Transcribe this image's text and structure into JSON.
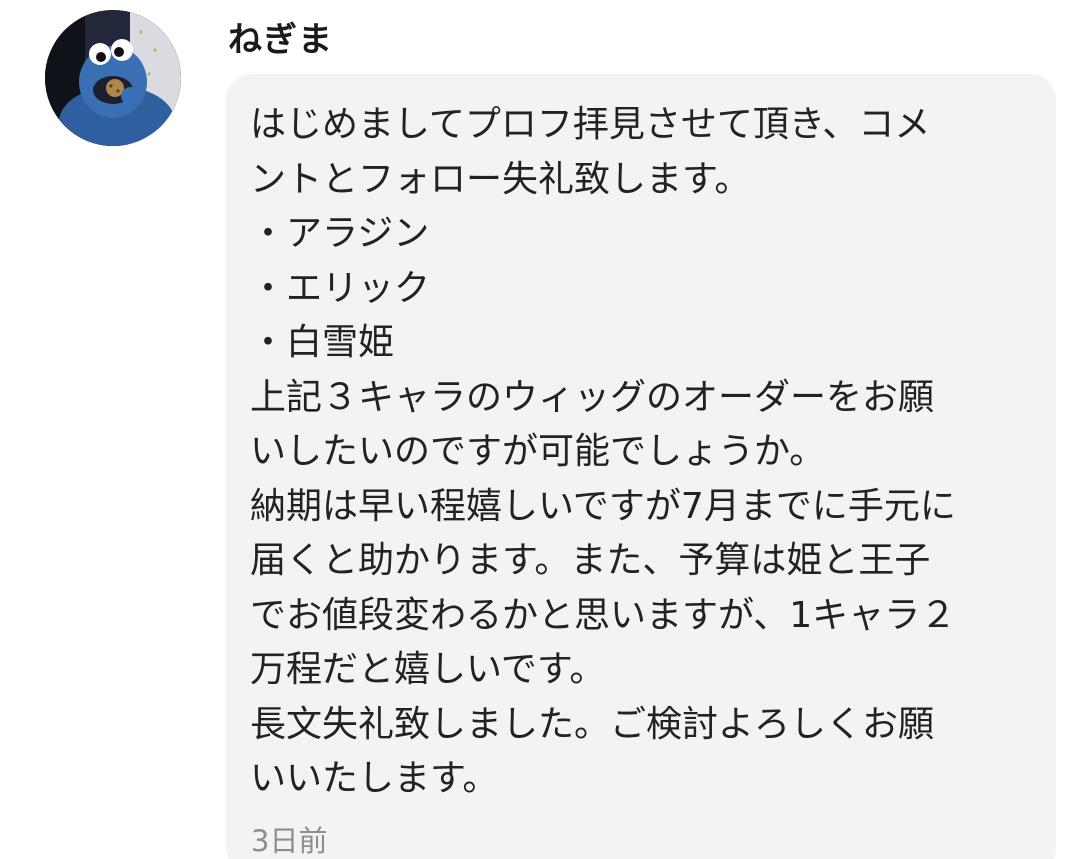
{
  "user": {
    "name": "ねぎま",
    "avatar_icon": "cookie-monster-avatar-icon"
  },
  "message": {
    "lines": [
      "はじめましてプロフ拝見させて頂き、コメ",
      "ントとフォロー失礼致します。",
      "・アラジン",
      "・エリック",
      "・白雪姫",
      "上記３キャラのウィッグのオーダーをお願",
      "いしたいのですが可能でしょうか。",
      "納期は早い程嬉しいですが7月までに手元に",
      "届くと助かります。また、予算は姫と王子",
      "でお値段変わるかと思いますが、1キャラ２",
      "万程だと嬉しいです。",
      "長文失礼致しました。ご検討よろしくお願",
      "いいたします。"
    ]
  },
  "timestamp": "3日前",
  "colors": {
    "bubble": "#f3f3f3",
    "text": "#222222",
    "timestamp": "#8e8e8e"
  }
}
